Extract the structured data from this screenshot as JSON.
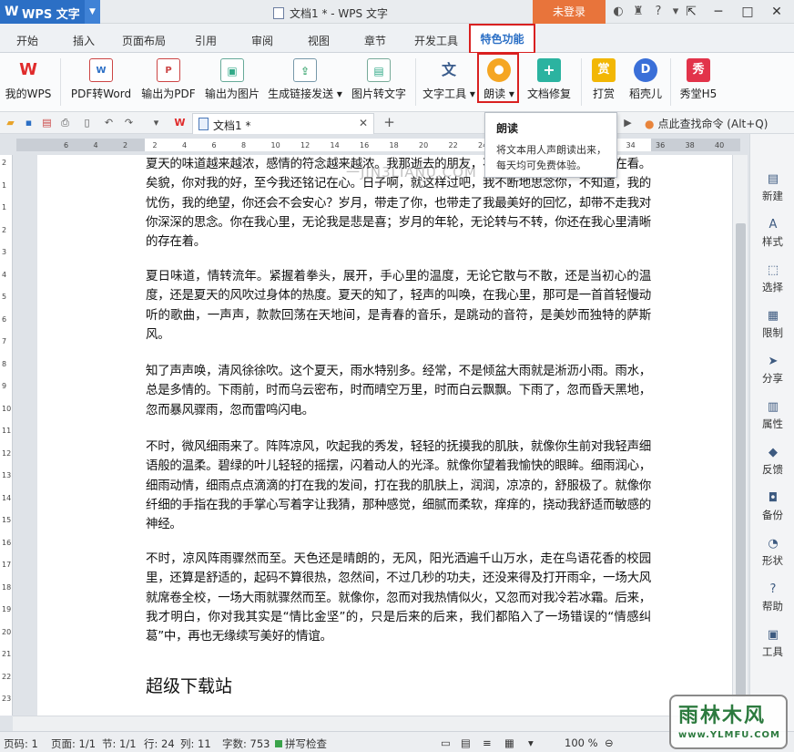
{
  "title_bar": {
    "app_name": "WPS 文字",
    "doc_title": "文档1 * - WPS 文字",
    "login": "未登录"
  },
  "tabs": [
    "开始",
    "插入",
    "页面布局",
    "引用",
    "审阅",
    "视图",
    "章节",
    "开发工具",
    "特色功能"
  ],
  "ribbon": [
    {
      "label": "我的WPS",
      "icon": "wps-logo-icon",
      "color": "#e02b2b"
    },
    {
      "label": "PDF转Word",
      "icon": "pdf-to-word-icon",
      "color": "#ffffff"
    },
    {
      "label": "输出为PDF",
      "icon": "export-pdf-icon",
      "color": "#ffffff"
    },
    {
      "label": "输出为图片",
      "icon": "export-image-icon",
      "color": "#ffffff"
    },
    {
      "label": "生成链接发送",
      "icon": "share-link-icon",
      "color": "#ffffff"
    },
    {
      "label": "图片转文字",
      "icon": "image-to-text-icon",
      "color": "#ffffff"
    },
    {
      "label": "文字工具",
      "icon": "text-tools-icon",
      "color": "#ffffff"
    },
    {
      "label": "朗读",
      "icon": "microphone-icon",
      "color": "#f5a623"
    },
    {
      "label": "文档修复",
      "icon": "document-repair-icon",
      "color": "#2bb3a0"
    },
    {
      "label": "打赏",
      "icon": "reward-icon",
      "color": "#f2b705"
    },
    {
      "label": "稻壳儿",
      "icon": "docer-icon",
      "color": "#3a6fd8"
    },
    {
      "label": "秀堂H5",
      "icon": "xiutang-icon",
      "color": "#e2334a"
    }
  ],
  "doc_tab": "文档1 *",
  "search_cmd": "点此查找命令 (Alt+Q)",
  "tooltip": {
    "title": "朗读",
    "desc": "将文本用人声朗读出来，每天均可免费体验。"
  },
  "watermark": "一JIN3LIANU.COM",
  "ruler_h": [
    "6",
    "4",
    "2",
    "2",
    "4",
    "6",
    "8",
    "10",
    "12",
    "14",
    "16",
    "18",
    "20",
    "22",
    "24",
    "26",
    "28",
    "30",
    "32",
    "34",
    "36",
    "38",
    "40"
  ],
  "ruler_v": [
    "2",
    "1",
    "1",
    "2",
    "3",
    "4",
    "5",
    "6",
    "7",
    "8",
    "9",
    "10",
    "11",
    "12",
    "13",
    "14",
    "15",
    "16",
    "17",
    "18",
    "19",
    "20",
    "21",
    "22",
    "23"
  ],
  "paragraphs": [
    "夏天的味道越来越浓，感情的符念越来越浓。我那逝去的朋友，不管你是否在看，那是否在看。矣貌，你对我的好，至今我还铭记在心。日子啊，就这样过吧，我不断地思念你，不知道，我的忧伤，我的绝望，你还会不会安心？岁月，带走了你，也带走了我最美好的回忆，却带不走我对你深深的思念。你在我心里，无论我是悲是喜；岁月的年轮，无论转与不转，你还在我心里清晰的存在着。",
    "夏日味道，情转流年。紧握着拳头，展开，手心里的温度，无论它散与不散，还是当初心的温度，还是夏天的风吹过身体的热度。夏天的知了，轻声的叫唤，在我心里，那可是一首首轻慢动听的歌曲，一声声，款款回荡在天地间，是青春的音乐，是跳动的音符，是美妙而独特的萨斯风。",
    "知了声声唤，清风徐徐吹。这个夏天，雨水特别多。经常，不是倾盆大雨就是淅沥小雨。雨水，总是多情的。下雨前，时而乌云密布，时而晴空万里，时而白云飘飘。下雨了，忽而昏天黑地，忽而暴风骤雨，忽而雷鸣闪电。",
    "不时，微风细雨来了。阵阵凉风，吹起我的秀发，轻轻的抚摸我的肌肤，就像你生前对我轻声细语般的温柔。碧绿的叶儿轻轻的摇摆，闪着动人的光泽。就像你望着我愉快的眼眸。细雨润心，细雨动情，细雨点点滴滴的打在我的发间，打在我的肌肤上，润润，凉凉的，舒服极了。就像你纤细的手指在我的手掌心写着字让我猜，那种感觉，细腻而柔软，痒痒的，挠动我舒适而敏感的神经。",
    "不时，凉风阵雨骤然而至。天色还是晴朗的，无风，阳光洒遍千山万水，走在鸟语花香的校园里，还算是舒适的，起码不算很热，忽然间，不过几秒的功夫，还没来得及打开雨伞，一场大风就席卷全校，一场大雨就骤然而至。就像你，忽而对我热情似火，又忽而对我冷若冰霜。后来，我才明白，你对我其实是“情比金坚”的，只是后来的后来，我们都陷入了一场错误的“情感纠葛”中，再也无缘续写美好的情谊。"
  ],
  "heading": "超级下载站",
  "sidebar": [
    {
      "label": "新建",
      "icon": "new-doc-icon"
    },
    {
      "label": "样式",
      "icon": "style-icon"
    },
    {
      "label": "选择",
      "icon": "select-icon"
    },
    {
      "label": "限制",
      "icon": "restrict-icon"
    },
    {
      "label": "分享",
      "icon": "share-icon"
    },
    {
      "label": "属性",
      "icon": "properties-icon"
    },
    {
      "label": "反馈",
      "icon": "feedback-icon"
    },
    {
      "label": "备份",
      "icon": "backup-icon"
    },
    {
      "label": "形状",
      "icon": "shape-icon"
    },
    {
      "label": "帮助",
      "icon": "help-icon"
    },
    {
      "label": "工具",
      "icon": "toolbox-icon"
    }
  ],
  "status": {
    "page_code": "页码: 1",
    "pages": "页面: 1/1",
    "section": "节: 1/1",
    "row": "行: 24",
    "col": "列: 11",
    "words": "字数: 753",
    "spellcheck": "拼写检查",
    "zoom": "100 %"
  },
  "brand_logo": {
    "text": "雨林木风",
    "url": "www.YLMFU.COM"
  }
}
